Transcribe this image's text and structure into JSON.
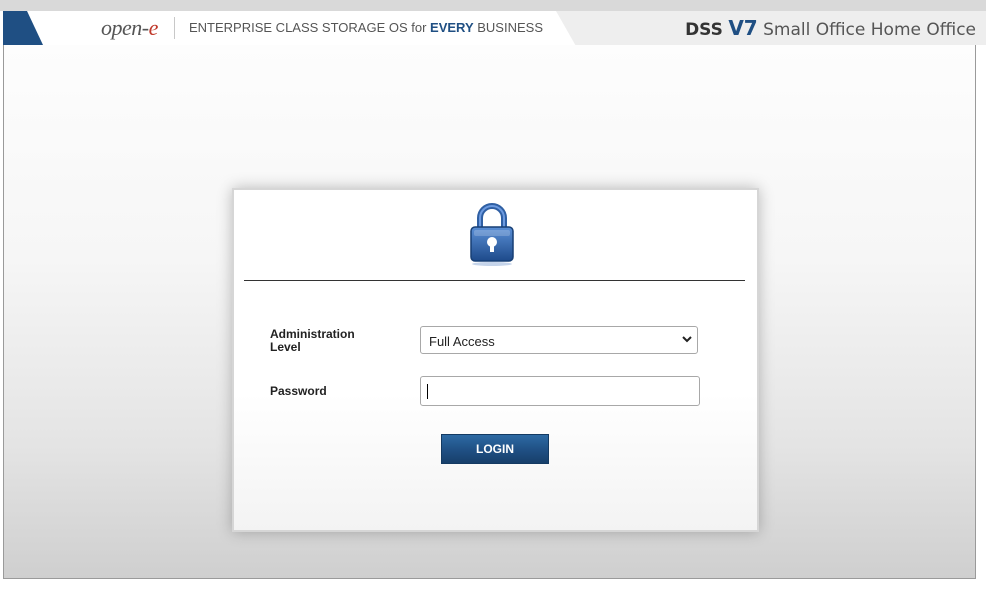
{
  "header": {
    "logo_text": "open-e",
    "tagline_pre": "ENTERPRISE CLASS STORAGE OS for ",
    "tagline_emph": "EVERY",
    "tagline_post": " BUSINESS",
    "product_name": "DSS",
    "product_version": "V7",
    "product_edition": "Small Office Home Office"
  },
  "login": {
    "lock_icon": "padlock-icon",
    "admin_level_label": "Administration Level",
    "admin_level_value": "Full Access",
    "admin_level_options": [
      "Full Access"
    ],
    "password_label": "Password",
    "password_value": "",
    "login_button": "LOGIN"
  },
  "colors": {
    "brand_blue": "#1f4f83",
    "logo_accent": "#c0392b"
  }
}
